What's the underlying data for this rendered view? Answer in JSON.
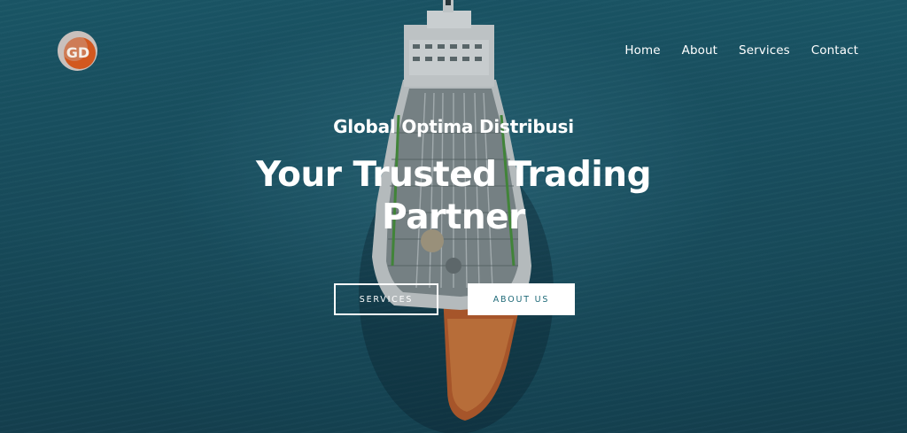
{
  "brand": {
    "logo_text": "GD",
    "logo_name": "global-optima-distribusi-logo"
  },
  "nav": {
    "items": [
      {
        "label": "Home"
      },
      {
        "label": "About"
      },
      {
        "label": "Services"
      },
      {
        "label": "Contact"
      }
    ]
  },
  "hero": {
    "eyebrow": "Global Optima Distribusi",
    "headline_line1": "Your Trusted Trading",
    "headline_line2": "Partner",
    "buttons": {
      "services": "SERVICES",
      "about": "ABOUT US"
    },
    "background": "aerial-view-of-tanker-ship-at-sea"
  },
  "colors": {
    "sea": "#1a5566",
    "button_text": "#1f6a78",
    "text": "#ffffff",
    "logo_orange": "#d2581f",
    "logo_ring": "#c9c0bc"
  }
}
